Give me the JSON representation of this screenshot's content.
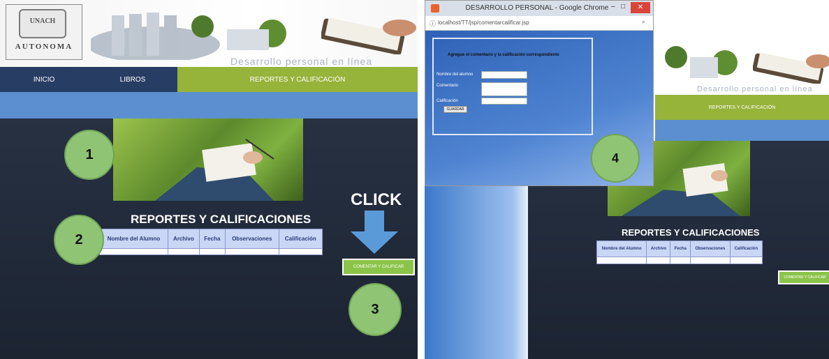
{
  "left_page": {
    "logo": {
      "seal_text": "UNACH",
      "word": "AUTONOMA"
    },
    "banner_subtitle": "Desarrollo personal en línea",
    "nav": {
      "inicio": "INICIO",
      "libros": "LIBROS",
      "reportes": "REPORTES Y CALIFICACIÓN"
    },
    "title": "REPORTES Y CALIFICACIONES",
    "table_headers": [
      "Nombre del Alumno",
      "Archivo",
      "Fecha",
      "Observaciones",
      "Calificación"
    ],
    "button_label": "COMENTAR Y CALIFICAR",
    "click_label": "CLICK",
    "steps": [
      "1",
      "2",
      "3"
    ]
  },
  "right_page": {
    "window_title": "DESARROLLO PERSONAL - Google Chrome",
    "url": "localhost/TT/jsp/comentarcalificar.jsp",
    "form_heading": "Agregue el comentario y la calificación correspondiente",
    "field_labels": [
      "Nombre del alumno",
      "Comentario",
      "Calificación"
    ],
    "save_label": "GUARDAR",
    "banner_subtitle": "Desarrollo personal en línea",
    "nav_reportes": "REPORTES Y CALIFICACIÓN",
    "title": "REPORTES Y CALIFICACIONES",
    "table_headers": [
      "Nombre del Alumno",
      "Archivo",
      "Fecha",
      "Observaciones",
      "Calificación"
    ],
    "button_label": "COMENTAR Y CALIFICAR",
    "step": "4"
  },
  "colors": {
    "nav_dark": "#273d63",
    "nav_green": "#96b33a",
    "band_blue": "#5b8fd0",
    "page_dark": "#232d3d",
    "button_green": "#8cc44a",
    "step_circle": "#8fc474"
  },
  "icons": [
    "unach-seal-logo",
    "down-arrow-icon",
    "chrome-app-icon",
    "page-info-icon",
    "search-icon",
    "minimize-icon",
    "maximize-icon",
    "close-icon"
  ]
}
